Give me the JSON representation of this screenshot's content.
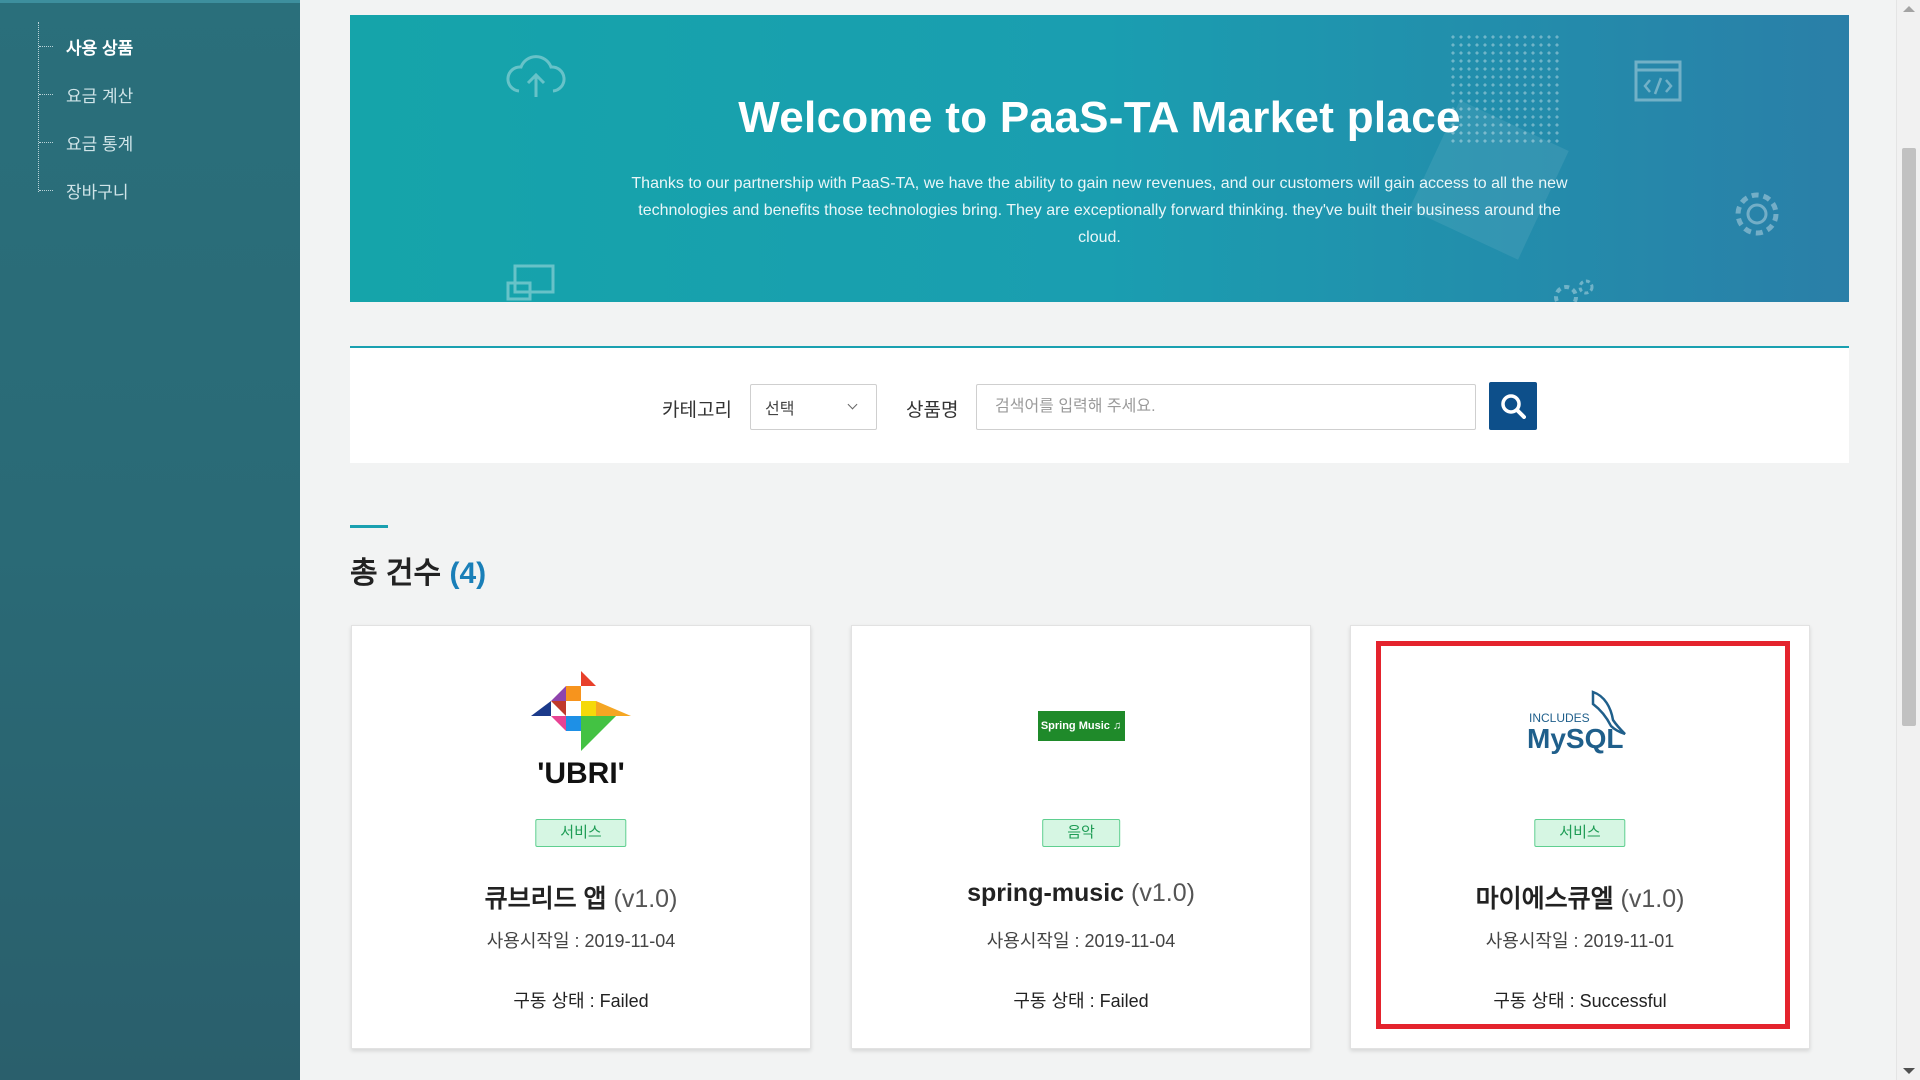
{
  "sidebar": {
    "items": [
      {
        "label": "사용 상품",
        "active": true
      },
      {
        "label": "요금 계산",
        "active": false
      },
      {
        "label": "요금 통계",
        "active": false
      },
      {
        "label": "장바구니",
        "active": false
      }
    ]
  },
  "hero": {
    "title": "Welcome to PaaS-TA Market place",
    "description": "Thanks to our partnership with PaaS-TA, we have the ability to gain new revenues, and our customers will gain access to all the new technologies and benefits those technologies bring. They are exceptionally forward thinking. they've built their business around the cloud.",
    "decorative_icons": [
      "cloud-upload-icon",
      "code-window-icon",
      "gear-icon",
      "monitor-icon",
      "gears-icon"
    ]
  },
  "search": {
    "category_label": "카테고리",
    "category_value": "선택",
    "product_label": "상품명",
    "placeholder": "검색어를 입력해 주세요.",
    "button_icon": "search-icon"
  },
  "summary": {
    "label": "총 건수",
    "count": "(4)"
  },
  "colors": {
    "sidebar_bg": "#2a6a76",
    "hero_start": "#15a4aa",
    "hero_end": "#2a7fa8",
    "search_button": "#0d4f8a",
    "badge_bg": "#d6f6e3",
    "badge_text": "#1e9c55",
    "highlight": "#e4232d",
    "count_accent": "#1a7fb8"
  },
  "cards": [
    {
      "logo": "cubrid-logo",
      "logo_text": "'UBRI'",
      "badge": "서비스",
      "name": "큐브리드 앱",
      "version": "(v1.0)",
      "date": "사용시작일 : 2019-11-04",
      "status": "구동 상태 : Failed"
    },
    {
      "logo": "spring-music-logo",
      "logo_text": "Spring Music ♫",
      "badge": "음악",
      "name": "spring-music",
      "version": "(v1.0)",
      "date": "사용시작일 : 2019-11-04",
      "status": "구동 상태 : Failed"
    },
    {
      "logo": "mysql-logo",
      "logo_text": "MySQL",
      "logo_subtext": "INCLUDES",
      "badge": "서비스",
      "name": "마이에스큐엘",
      "version": "(v1.0)",
      "date": "사용시작일 : 2019-11-01",
      "status": "구동 상태 : Successful",
      "highlighted": true
    }
  ]
}
